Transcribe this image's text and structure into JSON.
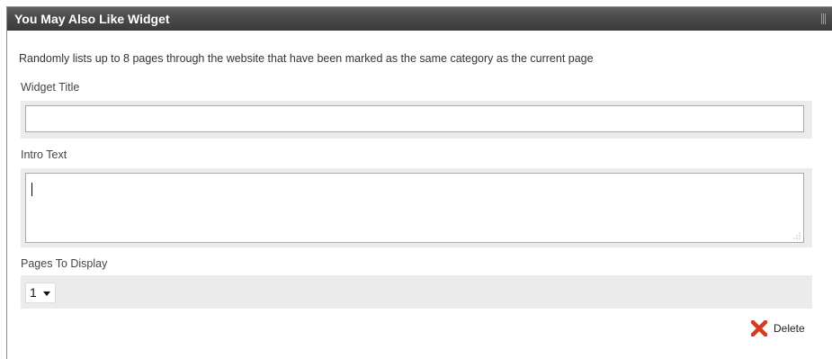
{
  "widget": {
    "title": "You May Also Like Widget",
    "description": "Randomly lists up to 8 pages through the website that have been marked as the same category as the current page"
  },
  "fields": {
    "widget_title": {
      "label": "Widget Title",
      "value": ""
    },
    "intro_text": {
      "label": "Intro Text",
      "value": ""
    },
    "pages_to_display": {
      "label": "Pages To Display",
      "selected": "1"
    }
  },
  "actions": {
    "delete_label": "Delete"
  },
  "colors": {
    "titlebar": "#4a4a4a",
    "field_background": "#ebebeb",
    "delete_icon": "#d83a1f"
  },
  "icons": {
    "delete": "x-icon",
    "drag_handle": "grip-icon",
    "dropdown": "chevron-down-icon",
    "textarea_resize": "resize-grip-icon"
  }
}
